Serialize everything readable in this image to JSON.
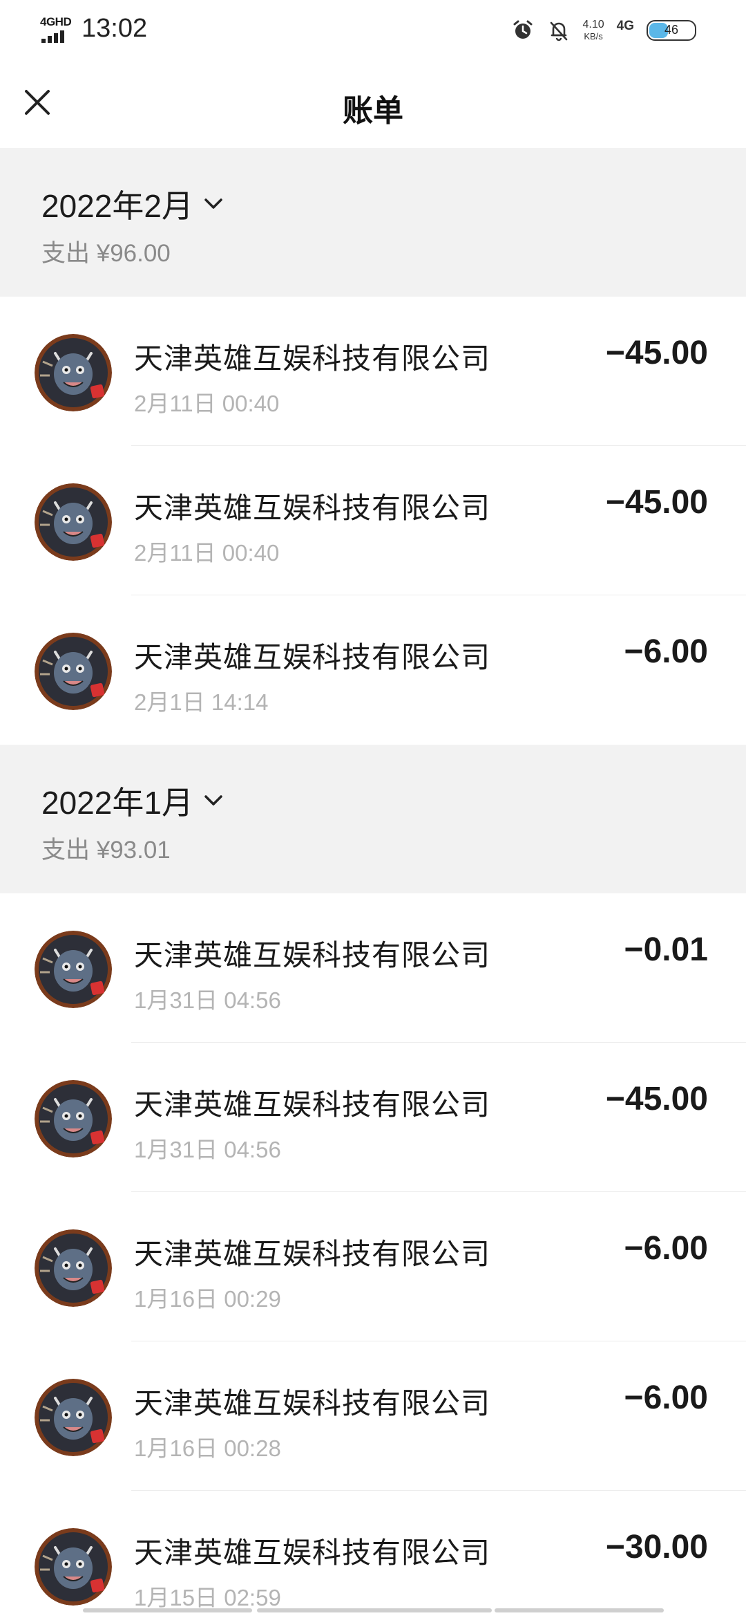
{
  "status_bar": {
    "network_label": "4GHD",
    "time": "13:02",
    "speed_value": "4.10",
    "speed_unit": "KB/s",
    "mobile_label": "4G",
    "battery_level": "46",
    "battery_fraction": 0.46,
    "battery_color": "#5bb7e8",
    "icons": [
      "signal-icon",
      "alarm-icon",
      "bell-off-icon",
      "battery-icon"
    ]
  },
  "nav": {
    "title": "账单",
    "close_icon": "close-icon"
  },
  "months": [
    {
      "title": "2022年2月",
      "summary": "支出 ¥96.00",
      "transactions": [
        {
          "name": "天津英雄互娱科技有限公司",
          "time": "2月11日 00:40",
          "amount": "−45.00"
        },
        {
          "name": "天津英雄互娱科技有限公司",
          "time": "2月11日 00:40",
          "amount": "−45.00"
        },
        {
          "name": "天津英雄互娱科技有限公司",
          "time": "2月1日 14:14",
          "amount": "−6.00"
        }
      ]
    },
    {
      "title": "2022年1月",
      "summary": "支出 ¥93.01",
      "transactions": [
        {
          "name": "天津英雄互娱科技有限公司",
          "time": "1月31日 04:56",
          "amount": "−0.01"
        },
        {
          "name": "天津英雄互娱科技有限公司",
          "time": "1月31日 04:56",
          "amount": "−45.00"
        },
        {
          "name": "天津英雄互娱科技有限公司",
          "time": "1月16日 00:29",
          "amount": "−6.00"
        },
        {
          "name": "天津英雄互娱科技有限公司",
          "time": "1月16日 00:28",
          "amount": "−6.00"
        },
        {
          "name": "天津英雄互娱科技有限公司",
          "time": "1月15日 02:59",
          "amount": "−30.00"
        }
      ]
    }
  ],
  "colors": {
    "section_bg": "#f2f2f2",
    "secondary_text": "#8a8a8a",
    "time_text": "#b4b4b4"
  }
}
